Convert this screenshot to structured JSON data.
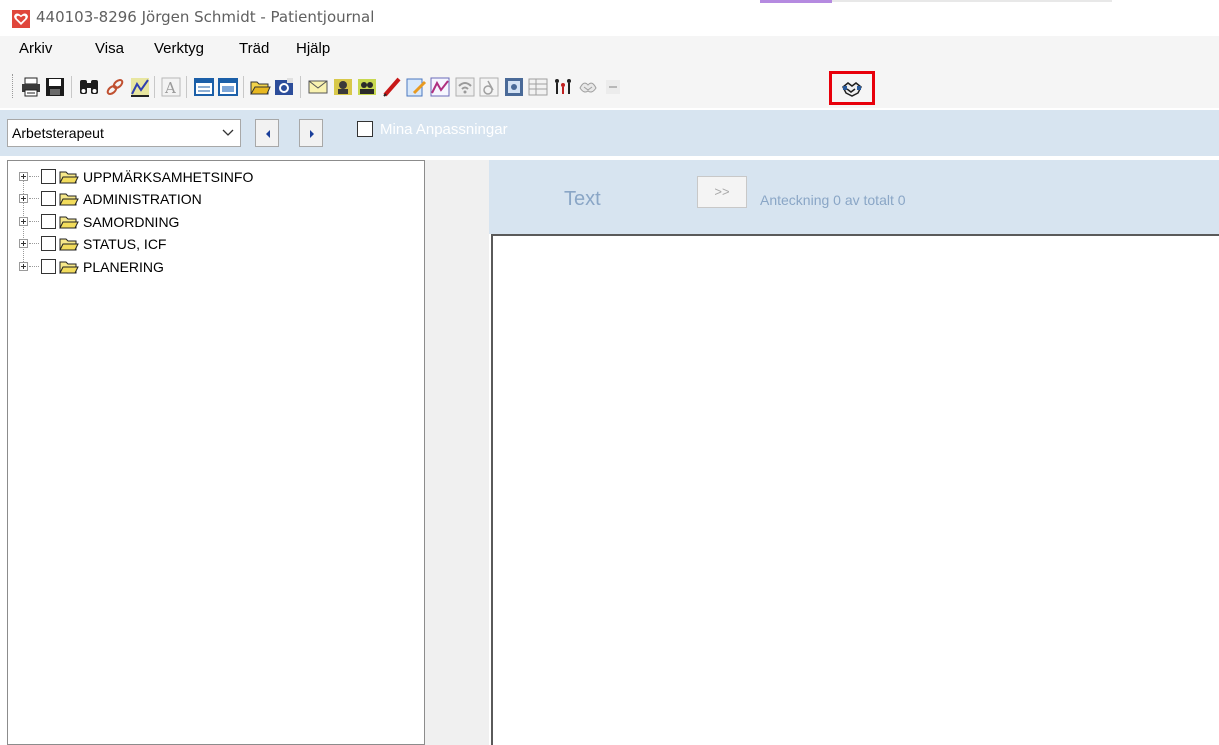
{
  "window": {
    "title": "440103-8296 Jörgen Schmidt - Patientjournal"
  },
  "menu": [
    "Arkiv",
    "Visa",
    "Verktyg",
    "Träd",
    "Hjälp"
  ],
  "toolbar": {
    "buttons": [
      "print-icon",
      "save-icon",
      "binoculars-icon",
      "link-icon",
      "chart-icon",
      "font-icon",
      "form-icon",
      "form-edit-icon",
      "folder-open-icon",
      "folder-refresh-icon",
      "envelope-icon",
      "person-search-icon",
      "persons-icon",
      "pen-icon",
      "note-edit-icon",
      "graph-icon",
      "wifi-icon",
      "accessibility-icon",
      "settings-icon",
      "table-icon",
      "family-icon",
      "hands-icon",
      "minus-icon",
      "handshake-icon"
    ],
    "highlighted": "handshake-icon"
  },
  "filter": {
    "profession": "Arbetsterapeut",
    "mina_anpassningar_label": "Mina Anpassningar",
    "mina_anpassningar_checked": false
  },
  "tree": {
    "items": [
      {
        "label": "UPPMÄRKSAMHETSINFO",
        "checked": false
      },
      {
        "label": "ADMINISTRATION",
        "checked": false
      },
      {
        "label": "SAMORDNING",
        "checked": false
      },
      {
        "label": "STATUS, ICF",
        "checked": false
      },
      {
        "label": "PLANERING",
        "checked": false
      }
    ]
  },
  "note": {
    "header_label": "Text",
    "next_button_label": ">>",
    "counter": "Anteckning 0 av totalt 0",
    "body": ""
  },
  "colors": {
    "panel_blue": "#d7e4f0",
    "highlight_red": "#e8000b",
    "muted_blue_text": "#8aa6c6"
  }
}
